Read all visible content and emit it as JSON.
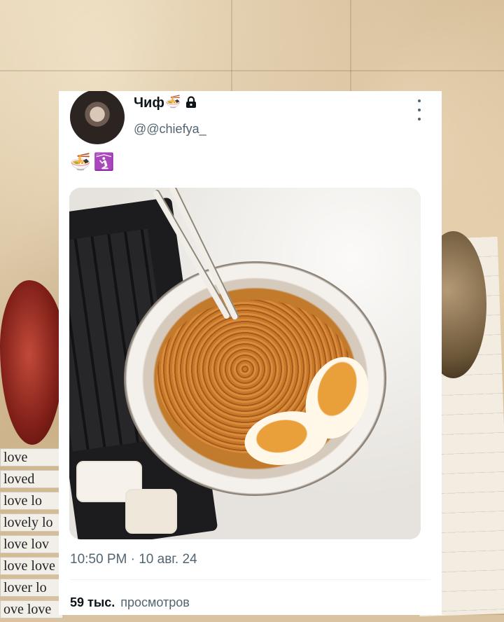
{
  "tweet": {
    "author": {
      "name": "Чиф",
      "name_emoji": "🍜",
      "lock_icon": "lock-icon",
      "handle": "@@chiefya_"
    },
    "text_emojis": [
      "🍜",
      "🛐"
    ],
    "timestamp": "10:50 PM · 10 авг. 24",
    "views": {
      "count": "59 тыс.",
      "label": "просмотров"
    }
  },
  "background": {
    "love_strips": [
      "love",
      "loved",
      "love lo",
      "lovely lo",
      "love lov",
      "love love",
      "lover lo",
      "ove love"
    ]
  }
}
